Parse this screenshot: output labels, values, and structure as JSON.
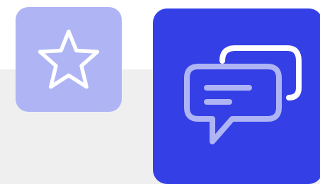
{
  "tiles": [
    {
      "name": "star-tile",
      "icon": "star-icon",
      "background": "#aeb4f4",
      "icon_color": "#ffffff"
    },
    {
      "name": "chat-tile",
      "icon": "chat-bubbles-icon",
      "background": "#3440e6",
      "icon_front_color": "#aeb4f4",
      "icon_back_color": "#ffffff"
    }
  ],
  "page": {
    "top_band_color": "#ffffff",
    "bottom_band_color": "#efefef"
  }
}
